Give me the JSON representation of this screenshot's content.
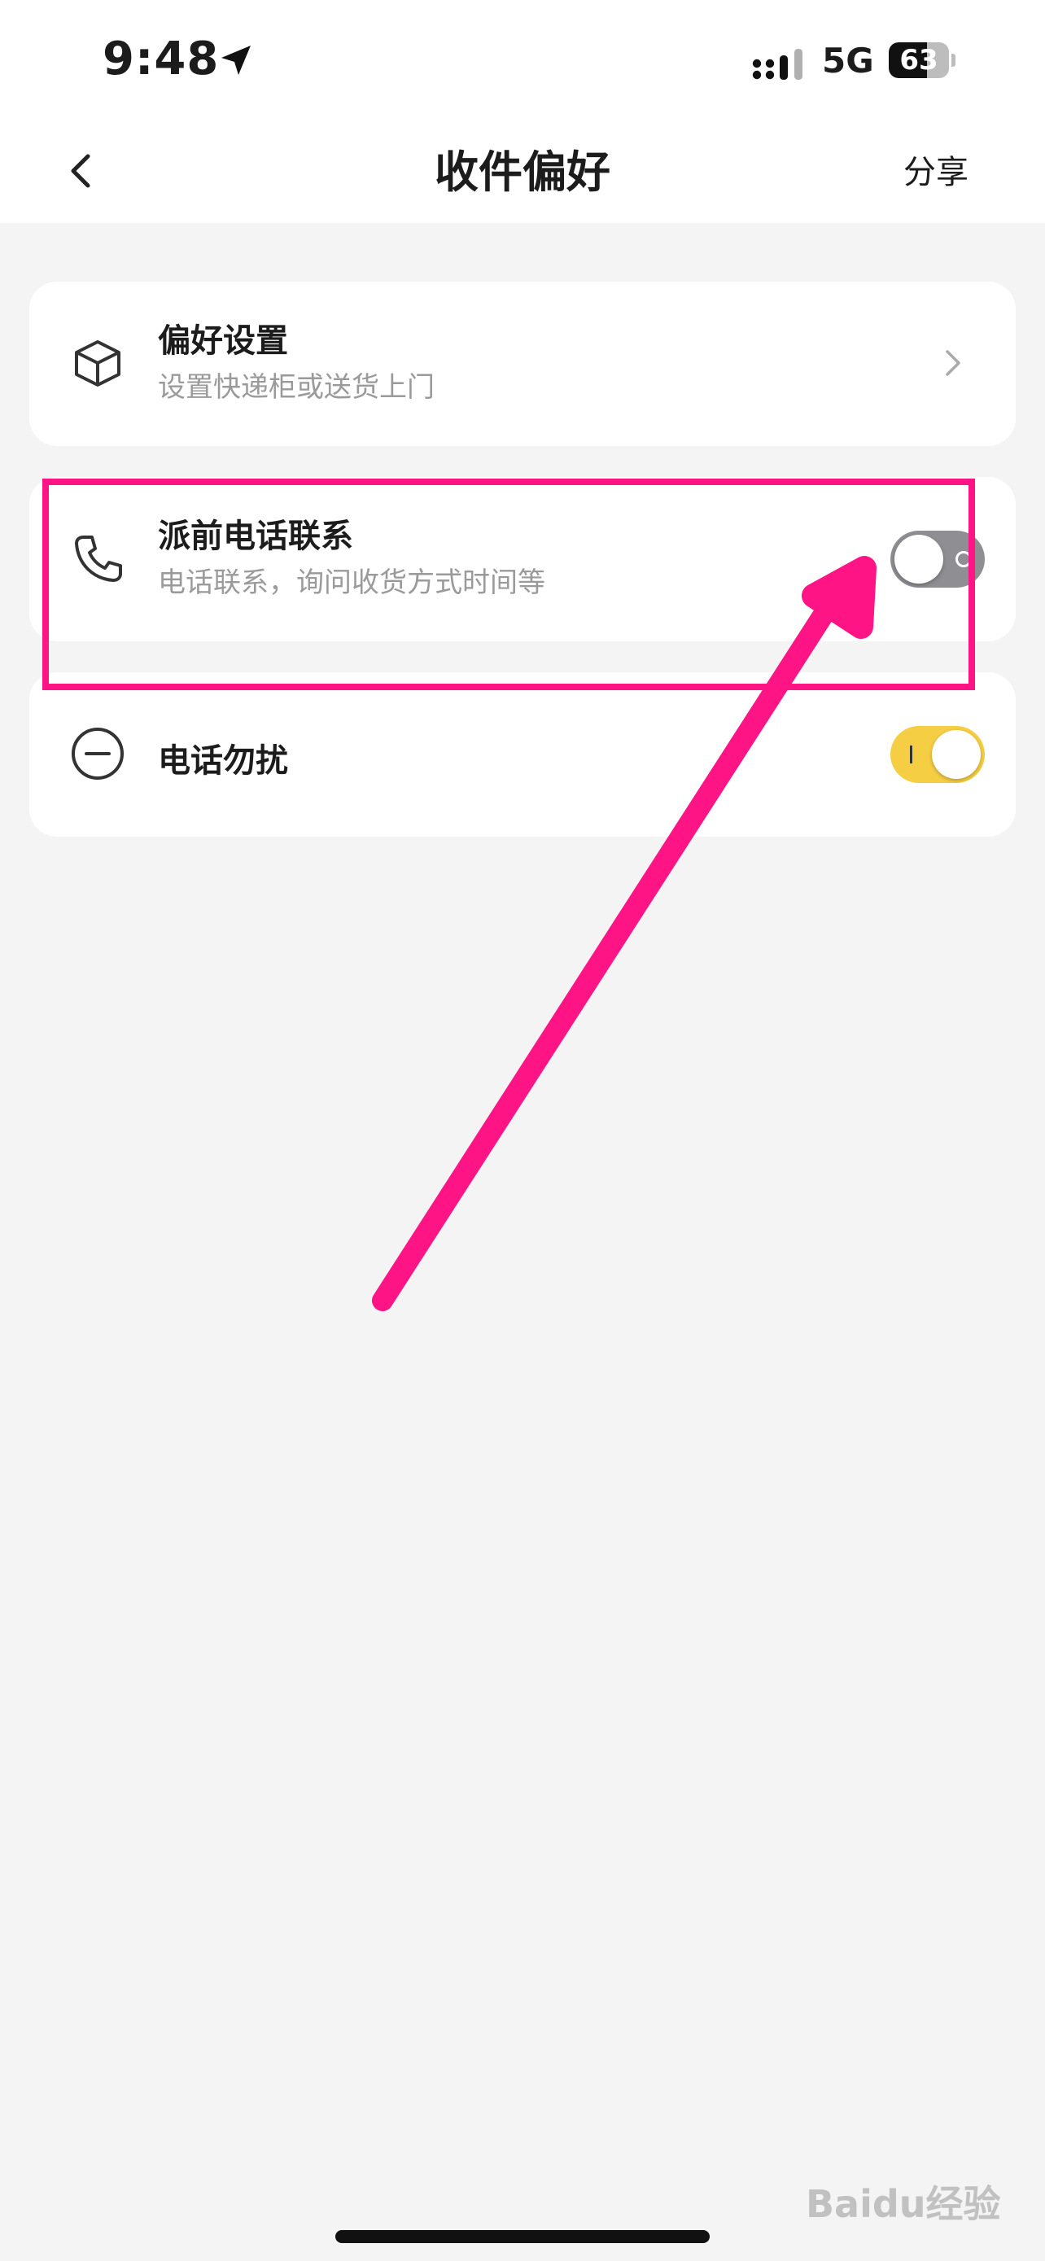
{
  "status_bar": {
    "time": "9:48",
    "network": "5G",
    "battery": "63",
    "battery_level": 0.63
  },
  "nav": {
    "title": "收件偏好",
    "share_label": "分享"
  },
  "rows": [
    {
      "title": "偏好设置",
      "subtitle": "设置快递柜或送货上门",
      "icon": "box-icon",
      "control": "chevron"
    },
    {
      "title": "派前电话联系",
      "subtitle": "电话联系，询问收货方式时间等",
      "icon": "phone-icon",
      "control": "toggle",
      "toggle_on": false
    },
    {
      "title": "电话勿扰",
      "icon": "minus-circle-icon",
      "control": "toggle",
      "toggle_on": true
    }
  ],
  "colors": {
    "accent": "#f6ce44",
    "annotation": "#ff1486",
    "toggle_off": "#8e8e93"
  },
  "watermark": "Baidu经验"
}
